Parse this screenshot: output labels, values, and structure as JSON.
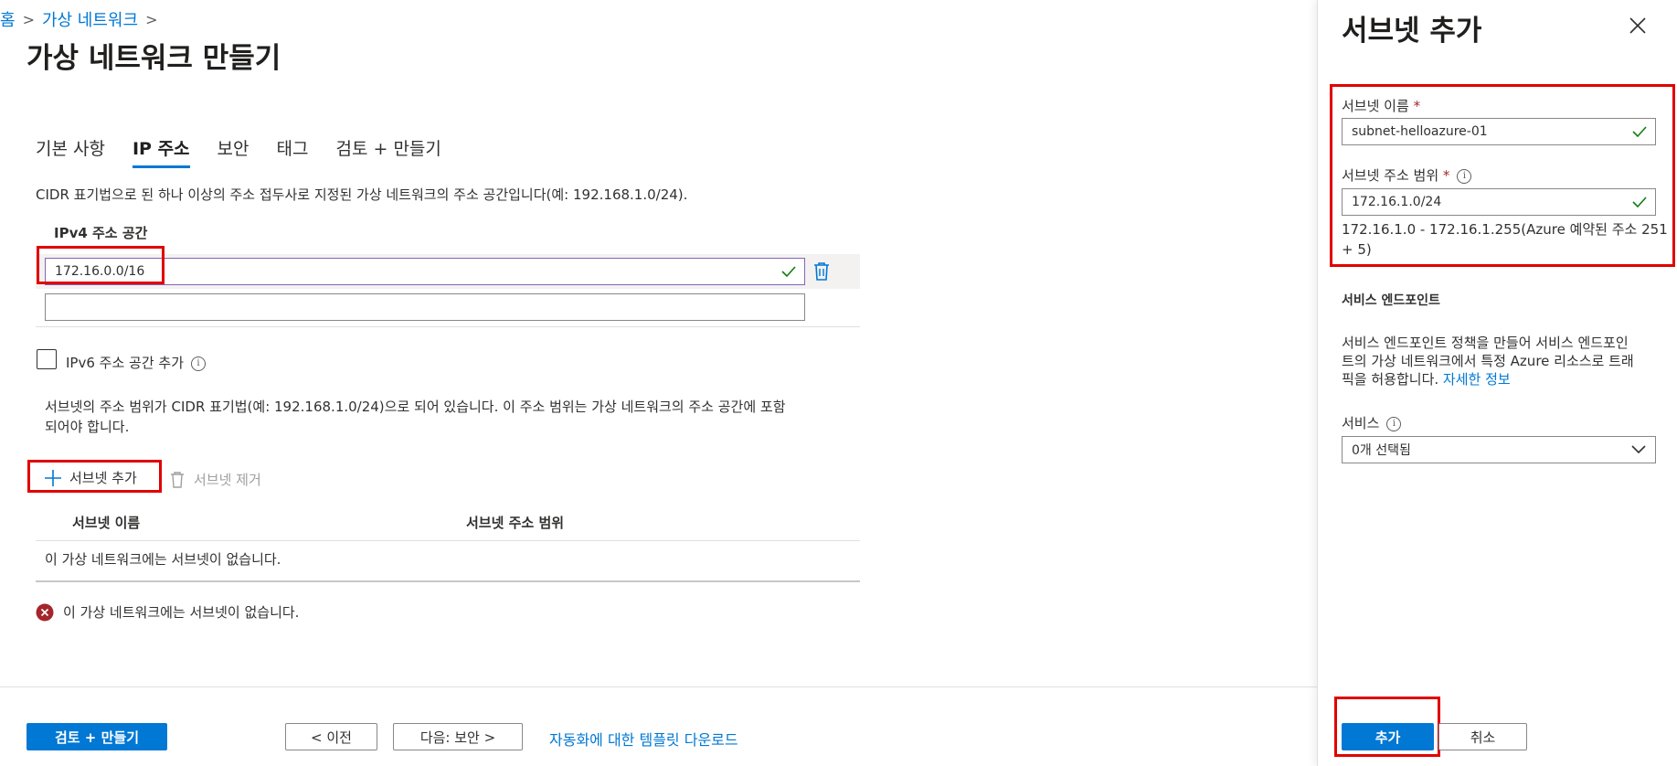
{
  "breadcrumb": {
    "home": "홈",
    "item1": "가상 네트워크"
  },
  "page": {
    "title": "가상 네트워크 만들기",
    "tabs": [
      {
        "label": "기본 사항"
      },
      {
        "label": "IP 주소"
      },
      {
        "label": "보안"
      },
      {
        "label": "태그"
      },
      {
        "label": "검토 + 만들기"
      }
    ],
    "description": "CIDR 표기법으로 된 하나 이상의 주소 접두사로 지정된 가상 네트워크의 주소 공간입니다(예: 192.168.1.0/24).",
    "ipv4_label": "IPv4 주소 공간",
    "ipv4_value": "172.16.0.0/16",
    "ipv4_empty_value": "",
    "ipv6_label": "IPv6 주소 공간 추가",
    "subnet_desc_line1": "서브넷의 주소 범위가 CIDR 표기법(예: 192.168.1.0/24)으로 되어 있습니다. 이 주소 범위는 가상 네트워크의 주소 공간에 포함",
    "subnet_desc_line2": "되어야 합니다.",
    "add_subnet": "서브넷 추가",
    "remove_subnet": "서브넷 제거",
    "table_headers": [
      "서브넷 이름",
      "서브넷 주소 범위"
    ],
    "table_empty": "이 가상 네트워크에는 서브넷이 없습니다.",
    "error_msg": "이 가상 네트워크에는 서브넷이 없습니다."
  },
  "footer": {
    "review_create": "검토 + 만들기",
    "prev": "< 이전",
    "next": "다음: 보안 >",
    "template_link": "자동화에 대한 템플릿 다운로드"
  },
  "panel": {
    "title": "서브넷 추가",
    "subnet_name_label": "서브넷 이름",
    "subnet_name_value": "subnet-helloazure-01",
    "subnet_range_label": "서브넷 주소 범위",
    "subnet_range_value": "172.16.1.0/24",
    "range_info_line1": "172.16.1.0 - 172.16.1.255(Azure 예약된 주소 251",
    "range_info_line2": "+ 5)",
    "service_endpoints_title": "서비스 엔드포인트",
    "endpoints_desc_line1": "서비스 엔드포인트 정책을 만들어 서비스 엔드포인",
    "endpoints_desc_line2": "트의 가상 네트워크에서 특정 Azure 리소스로 트래",
    "endpoints_desc_line3": "픽을 허용합니다.",
    "learn_more": "자세한 정보",
    "services_label": "서비스",
    "services_value": "0개 선택됨",
    "add_button": "추가",
    "cancel_button": "취소"
  },
  "colors": {
    "accent": "#0078d4",
    "highlight": "#e00000",
    "error": "#a4262c",
    "success": "#107c10"
  }
}
